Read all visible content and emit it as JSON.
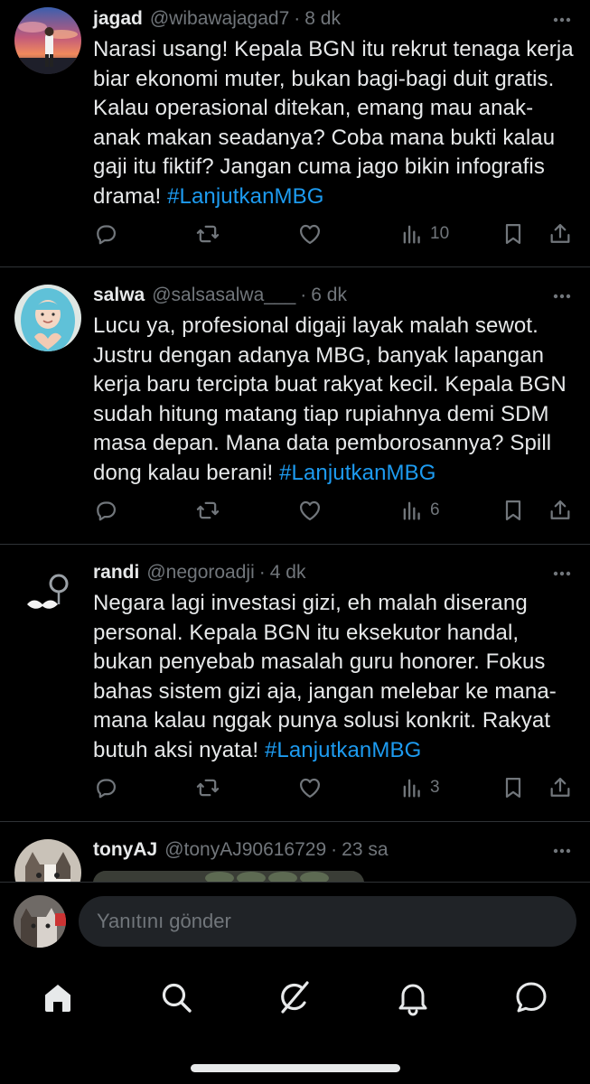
{
  "tweets": [
    {
      "name": "jagad",
      "handle": "@wibawajagad7",
      "time": "8 dk",
      "text": "Narasi usang! Kepala BGN itu rekrut tenaga kerja biar ekonomi muter, bukan bagi-bagi duit gratis. Kalau operasional ditekan, emang mau anak-anak makan seadanya? Coba mana bukti kalau gaji itu fiktif? Jangan cuma jago bikin infografis drama!",
      "hashtag": "#LanjutkanMBG",
      "views": "10"
    },
    {
      "name": "salwa",
      "handle": "@salsasalwa___",
      "time": "6 dk",
      "text": "Lucu ya, profesional digaji layak malah sewot. Justru dengan adanya MBG, banyak lapangan kerja baru tercipta buat rakyat kecil. Kepala BGN sudah hitung matang tiap rupiahnya demi SDM masa depan. Mana data pemborosannya? Spill dong kalau berani!",
      "hashtag": "#LanjutkanMBG",
      "views": "6"
    },
    {
      "name": "randi",
      "handle": "@negoroadji",
      "time": "4 dk",
      "text": "Negara lagi investasi gizi, eh malah diserang personal. Kepala BGN itu eksekutor handal, bukan penyebab masalah guru honorer. Fokus bahas sistem gizi aja, jangan melebar ke mana-mana kalau nggak punya solusi konkrit. Rakyat butuh aksi nyata!",
      "hashtag": "#LanjutkanMBG",
      "views": "3"
    },
    {
      "name": "tonyAJ",
      "handle": "@tonyAJ90616729",
      "time": "23 sa"
    }
  ],
  "composer": {
    "placeholder": "Yanıtını gönder"
  },
  "icons": {
    "reply": "reply-icon",
    "repost": "repost-icon",
    "like": "heart-icon",
    "views": "views-icon",
    "bookmark": "bookmark-icon",
    "share": "share-icon",
    "more": "more-icon",
    "home": "home-icon",
    "search": "search-icon",
    "grok": "grok-icon",
    "notifications": "bell-icon",
    "messages": "messages-icon"
  },
  "colors": {
    "background": "#000000",
    "text": "#e7e9ea",
    "muted": "#71767b",
    "link": "#1d9bf0",
    "divider": "#2f3336",
    "input": "#202327"
  }
}
